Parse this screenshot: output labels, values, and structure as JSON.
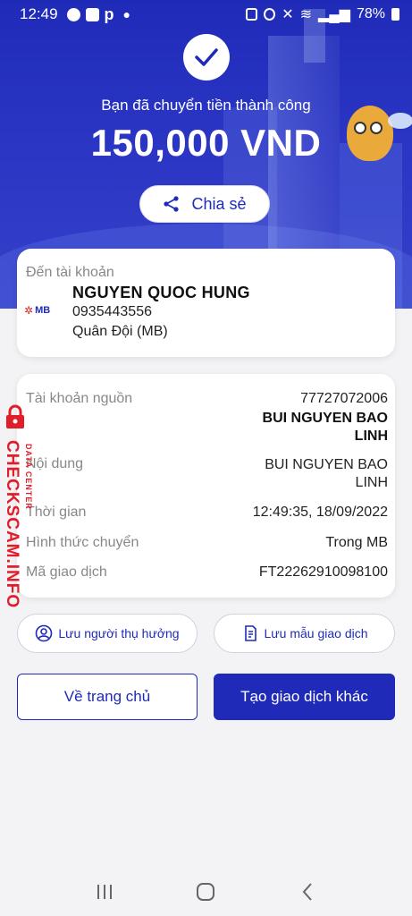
{
  "status_bar": {
    "time": "12:49",
    "battery": "78%"
  },
  "transfer": {
    "success_text": "Bạn đã chuyển tiền thành công",
    "amount": "150,000 VND",
    "share_label": "Chia sẻ"
  },
  "destination": {
    "label": "Đến tài khoản",
    "bank_logo": "MB",
    "name": "NGUYEN QUOC HUNG",
    "account": "0935443556",
    "bank": "Quân Đội (MB)"
  },
  "details": {
    "source_label": "Tài khoản nguồn",
    "source_account": "77727072006",
    "source_name_line1": "BUI NGUYEN BAO",
    "source_name_line2": "LINH",
    "content_label": "Nội dung",
    "content_line1": "BUI NGUYEN BAO",
    "content_line2": "LINH",
    "time_label": "Thời gian",
    "time_value": "12:49:35, 18/09/2022",
    "method_label": "Hình thức chuyển",
    "method_value": "Trong MB",
    "txn_label": "Mã giao dịch",
    "txn_value": "FT22262910098100"
  },
  "actions": {
    "save_beneficiary": "Lưu người thụ hưởng",
    "save_template": "Lưu mẫu giao dịch",
    "home": "Về trang chủ",
    "new_transaction": "Tạo giao dịch khác"
  },
  "watermark": {
    "main": "CHECKSCAM.INFO",
    "sub": "DATA CENTER"
  },
  "colors": {
    "brand": "#1f2bb8",
    "watermark": "#e11d2a"
  }
}
